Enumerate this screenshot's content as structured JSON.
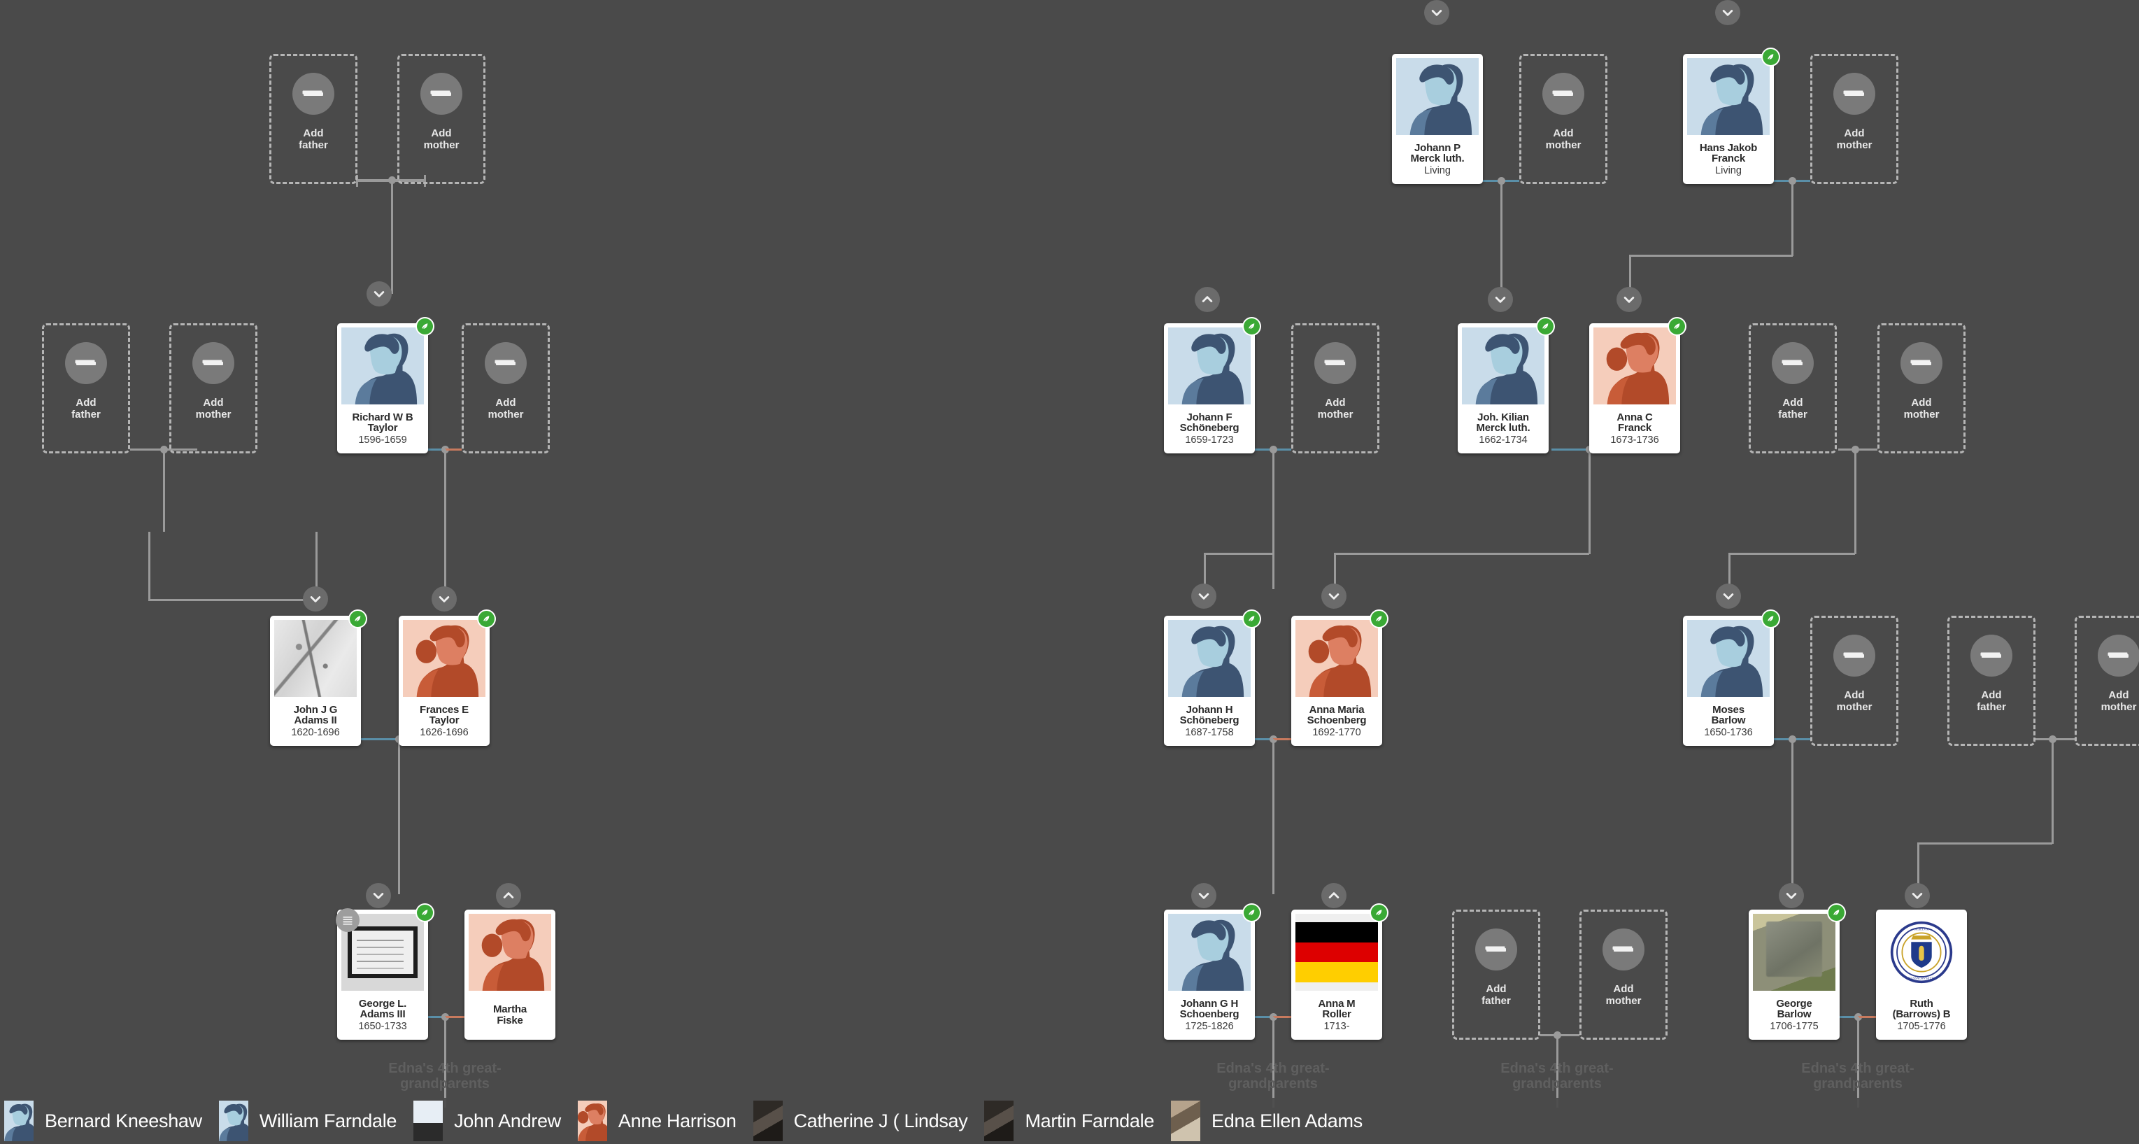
{
  "app": {
    "background_color": "#4a4a4a",
    "card_background": "#ffffff",
    "accent_green": "#3aa935",
    "male_tint": "#c9dcea",
    "female_tint": "#f5cdbb",
    "dashed_border": "#b5b5b5"
  },
  "add_labels": {
    "father_line1": "Add",
    "father_line2": "father",
    "mother_line1": "Add",
    "mother_line2": "mother"
  },
  "generation_labels": [
    {
      "line1": "Edna's 4th great-",
      "line2": "grandparents"
    },
    {
      "line1": "Edna's 4th great-",
      "line2": "grandparents"
    },
    {
      "line1": "Edna's 4th great-",
      "line2": "grandparents"
    },
    {
      "line1": "Edna's 4th great-",
      "line2": "grandparents"
    }
  ],
  "people": [
    {
      "id": "richard-w-b-taylor",
      "name_line1": "Richard W B",
      "name_line2": "Taylor",
      "years": "1596-1659",
      "sex": "male",
      "photo": "silhouette-male",
      "hint": true
    },
    {
      "id": "john-j-g-adams-ii",
      "name_line1": "John J G",
      "name_line2": "Adams II",
      "years": "1620-1696",
      "sex": "male",
      "photo": "map-document",
      "hint": true
    },
    {
      "id": "frances-e-taylor",
      "name_line1": "Frances E",
      "name_line2": "Taylor",
      "years": "1626-1696",
      "sex": "female",
      "photo": "silhouette-female",
      "hint": true
    },
    {
      "id": "george-l-adams-iii",
      "name_line1": "George L.",
      "name_line2": "Adams III",
      "years": "1650-1733",
      "sex": "male",
      "photo": "record-document",
      "hint": true,
      "stack": true
    },
    {
      "id": "martha-fiske",
      "name_line1": "Martha",
      "name_line2": "Fiske",
      "years": "",
      "sex": "female",
      "photo": "silhouette-female",
      "hint": false
    },
    {
      "id": "johann-p-merck-luth",
      "name_line1": "Johann P",
      "name_line2": "Merck luth.",
      "years": "Living",
      "sex": "male",
      "photo": "silhouette-male",
      "hint": false
    },
    {
      "id": "hans-jakob-franck",
      "name_line1": "Hans Jakob",
      "name_line2": "Franck",
      "years": "Living",
      "sex": "male",
      "photo": "silhouette-male",
      "hint": true
    },
    {
      "id": "johann-f-schoneberg",
      "name_line1": "Johann F",
      "name_line2": "Schöneberg",
      "years": "1659-1723",
      "sex": "male",
      "photo": "silhouette-male",
      "hint": true
    },
    {
      "id": "joh-kilian-merck-luth",
      "name_line1": "Joh. Kilian",
      "name_line2": "Merck luth.",
      "years": "1662-1734",
      "sex": "male",
      "photo": "silhouette-male",
      "hint": true
    },
    {
      "id": "anna-c-franck",
      "name_line1": "Anna C",
      "name_line2": "Franck",
      "years": "1673-1736",
      "sex": "female",
      "photo": "silhouette-female",
      "hint": true
    },
    {
      "id": "johann-h-schoneberg",
      "name_line1": "Johann H",
      "name_line2": "Schöneberg",
      "years": "1687-1758",
      "sex": "male",
      "photo": "silhouette-male",
      "hint": true
    },
    {
      "id": "anna-maria-schoenberg",
      "name_line1": "Anna Maria",
      "name_line2": "Schoenberg",
      "years": "1692-1770",
      "sex": "female",
      "photo": "silhouette-female",
      "hint": true
    },
    {
      "id": "moses-barlow",
      "name_line1": "Moses",
      "name_line2": "Barlow",
      "years": "1650-1736",
      "sex": "male",
      "photo": "silhouette-male",
      "hint": true
    },
    {
      "id": "johann-g-h-schoenberg",
      "name_line1": "Johann G H",
      "name_line2": "Schoenberg",
      "years": "1725-1826",
      "sex": "male",
      "photo": "silhouette-male",
      "hint": true
    },
    {
      "id": "anna-m-roller",
      "name_line1": "Anna M",
      "name_line2": "Roller",
      "years": "1713-",
      "sex": "female",
      "photo": "german-flag",
      "hint": true
    },
    {
      "id": "george-barlow",
      "name_line1": "George",
      "name_line2": "Barlow",
      "years": "1706-1775",
      "sex": "male",
      "photo": "gravestone-photo",
      "hint": true
    },
    {
      "id": "ruth-barrows-b",
      "name_line1": "Ruth",
      "name_line2": "(Barrows) B",
      "years": "1705-1776",
      "sex": "female",
      "photo": "massachusetts-seal",
      "hint": false
    }
  ],
  "people_bar": {
    "items": [
      {
        "name": "Bernard Kneeshaw",
        "thumb": "silhouette-male"
      },
      {
        "name": "William Farndale",
        "thumb": "silhouette-male"
      },
      {
        "name": "John Andrew",
        "thumb": "document-photo"
      },
      {
        "name": "Anne Harrison",
        "thumb": "silhouette-female"
      },
      {
        "name": "Catherine J ( Lindsay",
        "thumb": "portrait-photo-male"
      },
      {
        "name": "Martin Farndale",
        "thumb": "portrait-photo-male"
      },
      {
        "name": "Edna Ellen Adams",
        "thumb": "portrait-photo-female"
      }
    ]
  },
  "icons": {
    "chevron_down": "chevron-down-icon",
    "chevron_up": "chevron-up-icon",
    "plus": "plus-icon",
    "leaf_hint": "leaf-hint-icon",
    "record_stack": "record-stack-icon"
  }
}
